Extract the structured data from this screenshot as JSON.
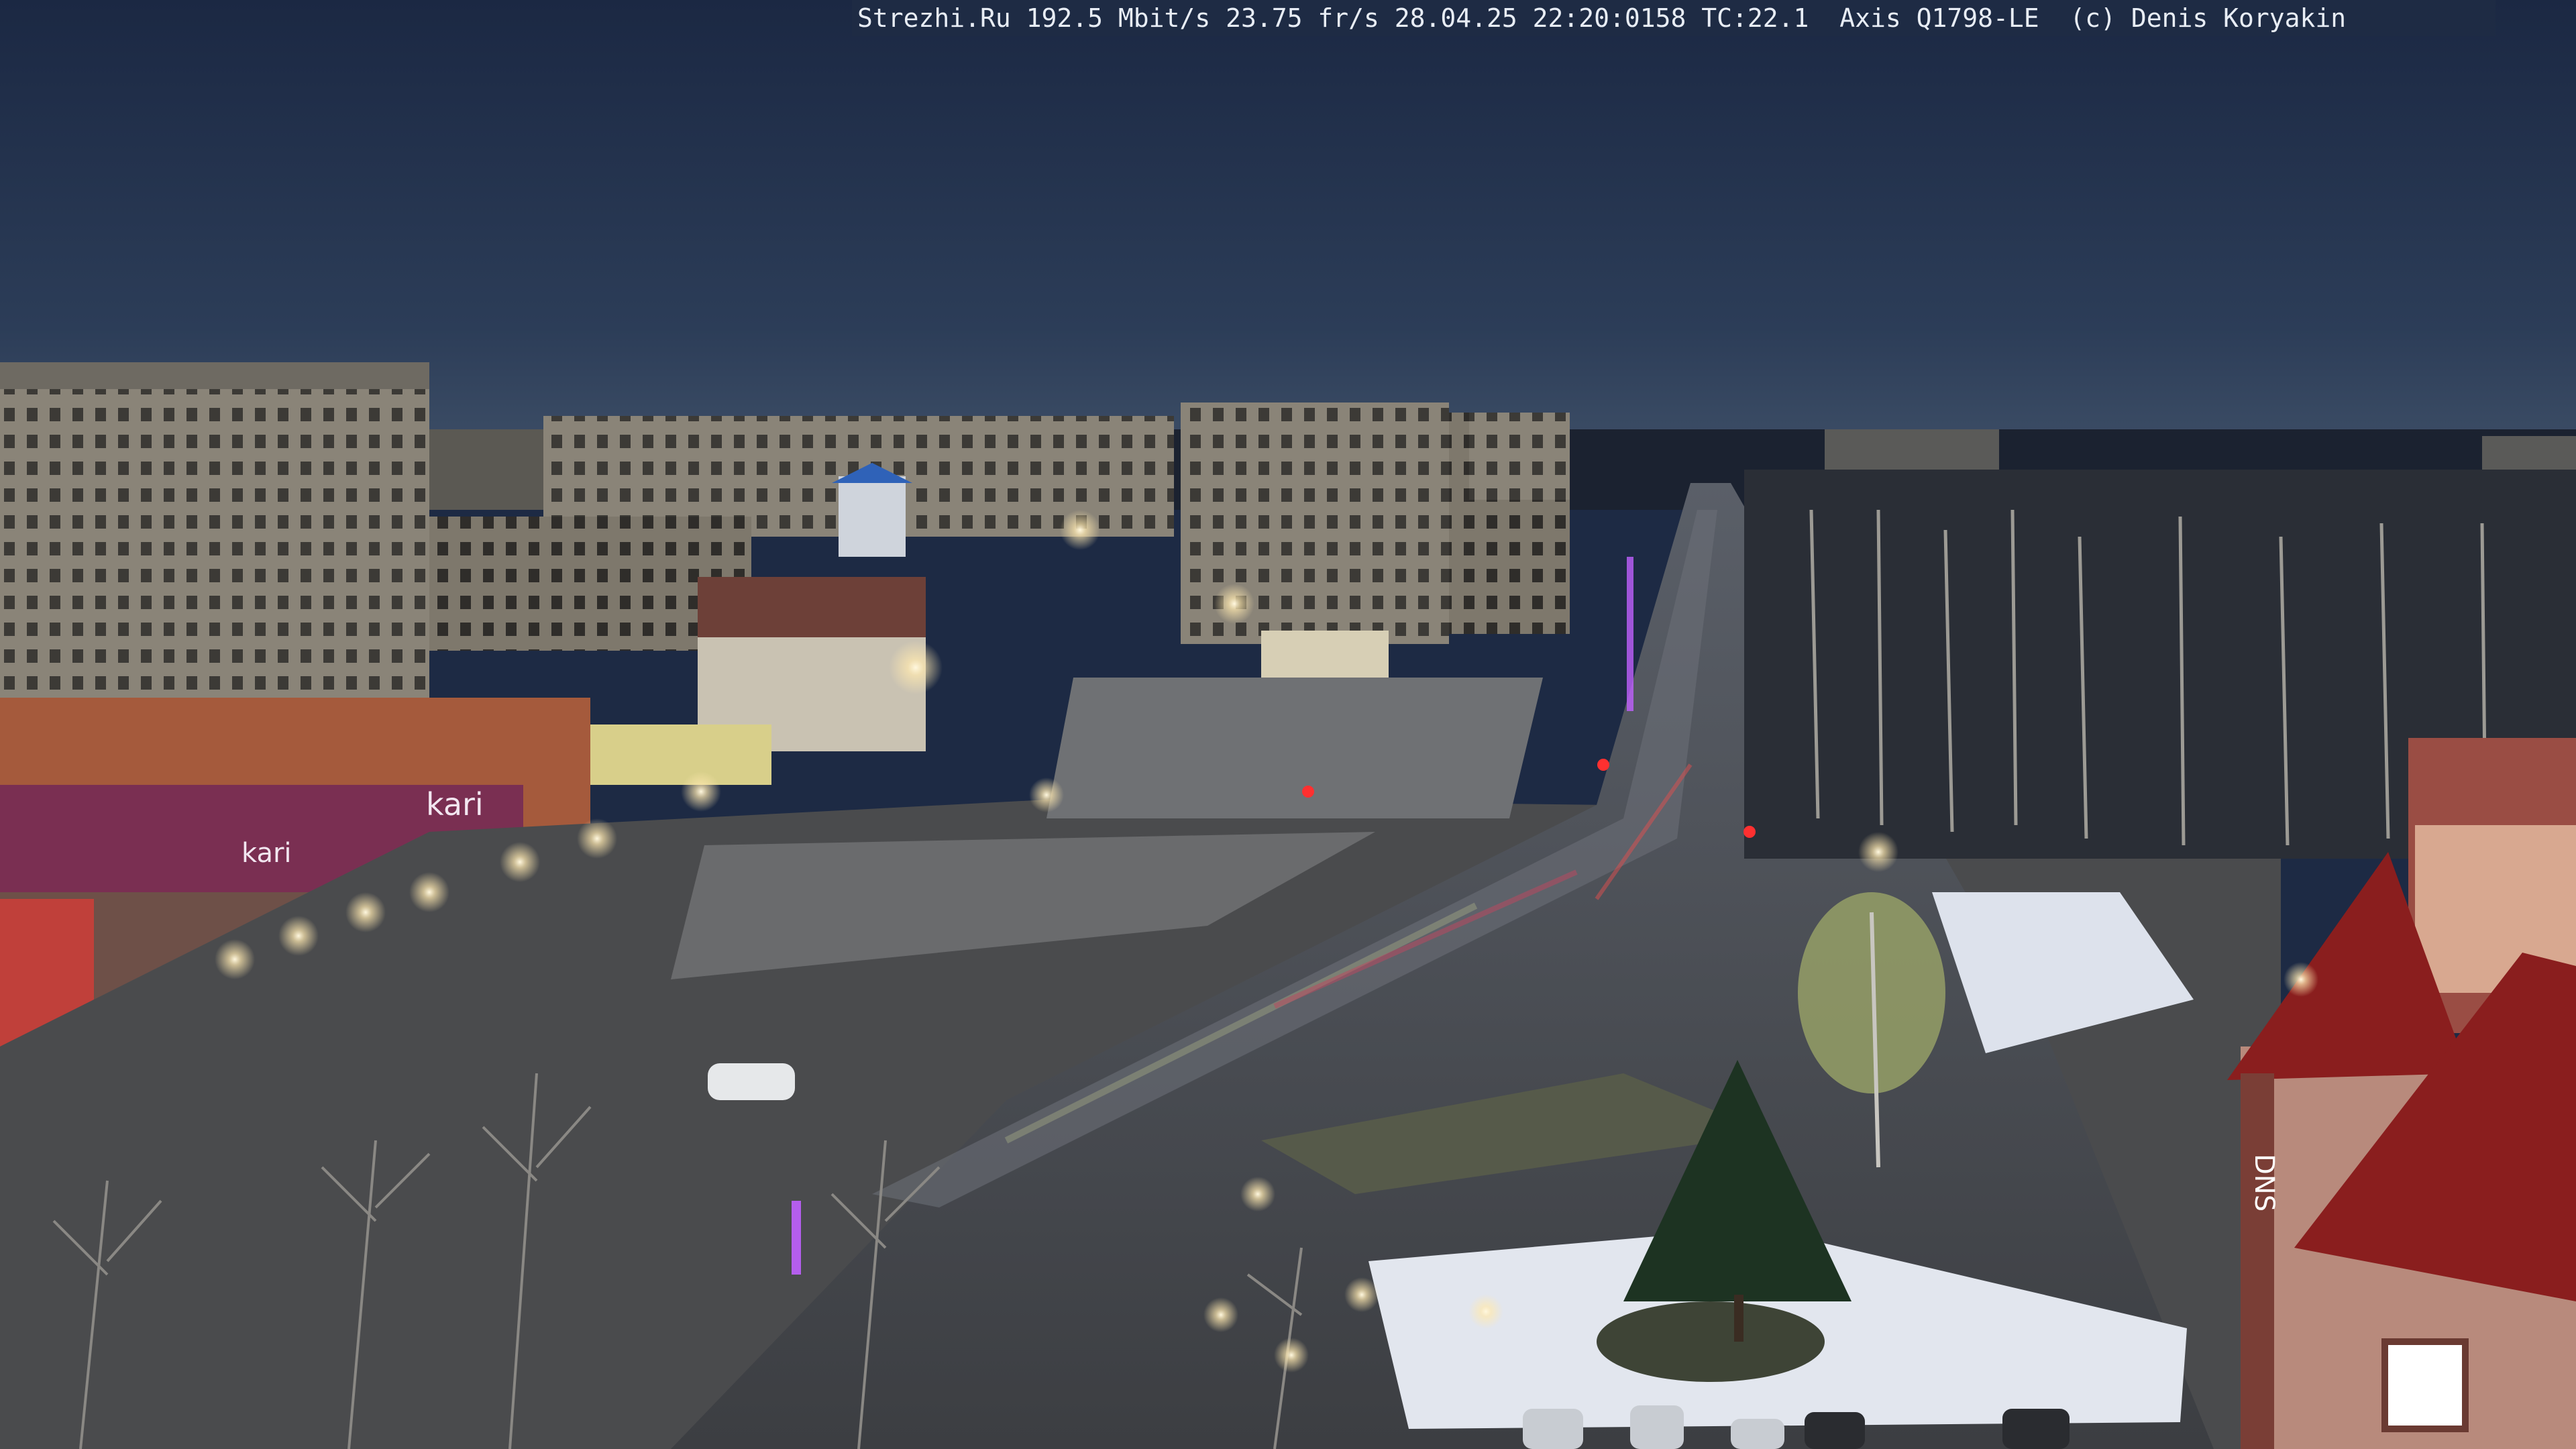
{
  "camera_overlay": {
    "text": "Strezhi.Ru 192.5 Mbit/s 23.75 fr/s 28.04.25 22:20:0158 TC:22.1  Axis Q1798-LE  (c) Denis Koryakin"
  },
  "signs": {
    "shop_left": "kari",
    "shop_left_small": "kari",
    "store_right": "DNS"
  },
  "colors": {
    "sky_top": "#1c2944",
    "sky_horizon": "#3d5068",
    "ground": "#4a4b4d",
    "snow": "#e2e6ee",
    "brick_roof": "#8a1e1e",
    "lamp": "#fff4d8",
    "garland": "#c060ff"
  }
}
